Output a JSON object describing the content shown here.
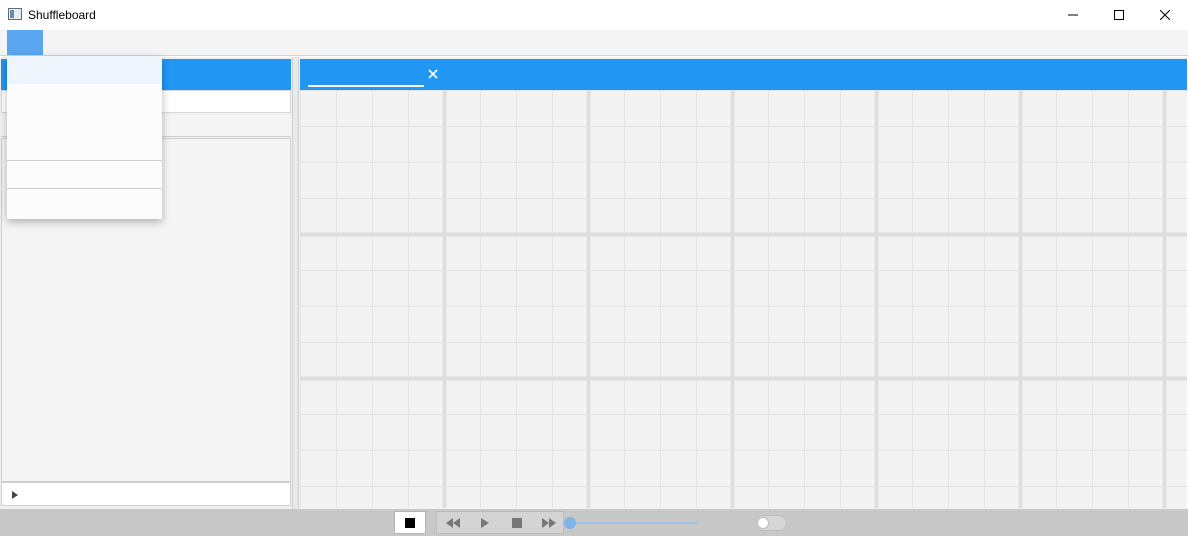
{
  "window": {
    "title": "Shuffleboard",
    "minimize_icon": "minimize-icon",
    "maximize_icon": "maximize-icon",
    "close_icon": "close-icon"
  },
  "menubar": {
    "items": [
      ""
    ]
  },
  "dropdown": {
    "items": [
      "",
      "",
      "",
      "",
      ""
    ]
  },
  "left_panel": {
    "header": "",
    "bottom_expander_icon": "triangle-right-icon"
  },
  "main": {
    "tabs": [
      {
        "label": "",
        "close_icon": "close-icon"
      }
    ]
  },
  "playback": {
    "controls": [
      "stop",
      "rewind",
      "play",
      "stop",
      "fast-forward"
    ],
    "progress": 0,
    "toggle_on": false
  },
  "colors": {
    "accent": "#2196f3",
    "menu_highlight": "#5aa7ef",
    "slider": "#7db6e6"
  }
}
